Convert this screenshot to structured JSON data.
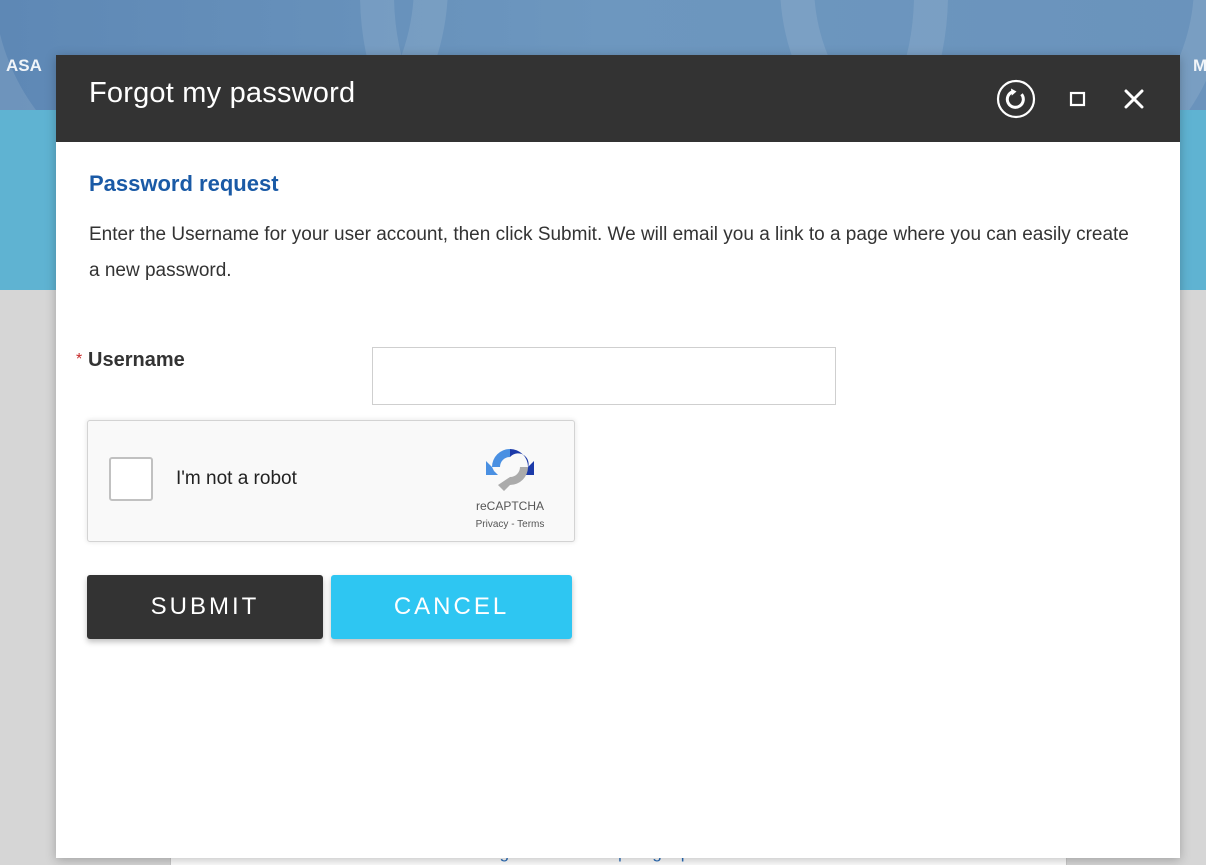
{
  "background": {
    "left_text": "ASA",
    "right_text": "M",
    "links_text": "Forgot username? | Forgot password?"
  },
  "dialog": {
    "title": "Forgot my password",
    "controls": {
      "refresh_icon": "refresh-icon",
      "maximize_icon": "maximize-icon",
      "close_icon": "close-icon"
    }
  },
  "form": {
    "section_title": "Password request",
    "description": "Enter the Username for your user account, then click Submit. We will email you a link to a page where you can easily create a new password.",
    "required_marker": "*",
    "username_label": "Username",
    "username_value": ""
  },
  "recaptcha": {
    "checkbox_label": "I'm not a robot",
    "brand": "reCAPTCHA",
    "privacy": "Privacy",
    "separator": " - ",
    "terms": "Terms"
  },
  "buttons": {
    "submit": "SUBMIT",
    "cancel": "CANCEL"
  },
  "colors": {
    "title_bar": "#333333",
    "section_title": "#1a5aa6",
    "submit_bg": "#333333",
    "cancel_bg": "#2ec6f2",
    "required_star": "#c62828"
  }
}
